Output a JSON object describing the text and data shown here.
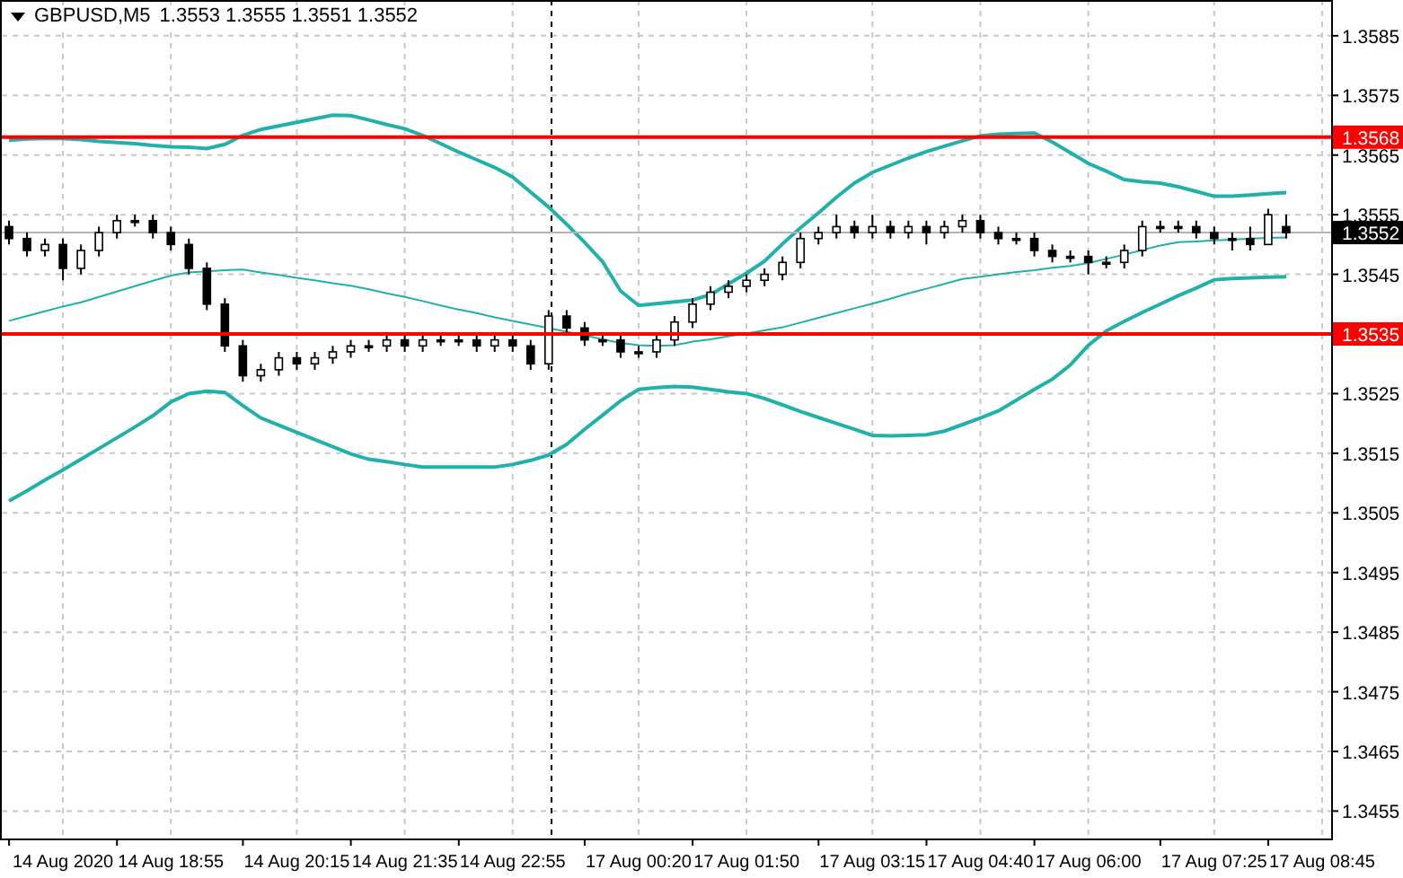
{
  "title": {
    "symbol": "GBPUSD,M5",
    "values": [
      "1.3553",
      "1.3555",
      "1.3551",
      "1.3552"
    ]
  },
  "chart_data": {
    "type": "candlestick",
    "grid": true,
    "categories": [
      null,
      null,
      null,
      "14 Aug 2020",
      null,
      null,
      null,
      null,
      null,
      "14 Aug 18:55",
      null,
      null,
      null,
      null,
      null,
      null,
      "14 Aug 20:15",
      null,
      null,
      null,
      null,
      null,
      "14 Aug 21:35",
      null,
      null,
      null,
      null,
      null,
      "14 Aug 22:55",
      null,
      null,
      null,
      null,
      null,
      null,
      "17 Aug 00:20",
      null,
      null,
      null,
      null,
      null,
      "17 Aug 01:50",
      null,
      null,
      null,
      null,
      null,
      null,
      "17 Aug 03:15",
      null,
      null,
      null,
      null,
      null,
      "17 Aug 04:40",
      null,
      null,
      null,
      null,
      null,
      "17 Aug 06:00",
      null,
      null,
      null,
      null,
      null,
      null,
      "17 Aug 07:25",
      null,
      null,
      null,
      null,
      null,
      "17 Aug 08:45"
    ],
    "ylim": [
      1.34504,
      1.3591
    ],
    "yticks": [
      {
        "value": 1.3455,
        "label": "1.3455"
      },
      {
        "value": 1.3465,
        "label": "1.3465"
      },
      {
        "value": 1.3475,
        "label": "1.3475"
      },
      {
        "value": 1.3485,
        "label": "1.3485"
      },
      {
        "value": 1.3495,
        "label": "1.3495"
      },
      {
        "value": 1.3505,
        "label": "1.3505"
      },
      {
        "value": 1.3515,
        "label": "1.3515"
      },
      {
        "value": 1.3525,
        "label": "1.3525"
      },
      {
        "value": 1.3545,
        "label": "1.3545"
      },
      {
        "value": 1.3555,
        "label": "1.3555"
      },
      {
        "value": 1.3565,
        "label": "1.3565"
      },
      {
        "value": 1.3575,
        "label": "1.3575"
      },
      {
        "value": 1.3585,
        "label": "1.3585"
      }
    ],
    "ohlc": [
      [
        1.3553,
        1.3554,
        1.355,
        1.3551
      ],
      [
        1.3551,
        1.3552,
        1.3548,
        1.3549
      ],
      [
        1.3549,
        1.3551,
        1.3548,
        1.355
      ],
      [
        1.355,
        1.3551,
        1.3544,
        1.3546
      ],
      [
        1.3546,
        1.355,
        1.3545,
        1.3549
      ],
      [
        1.3549,
        1.3553,
        1.3548,
        1.3552
      ],
      [
        1.3552,
        1.3555,
        1.3551,
        1.3554
      ],
      [
        1.3554,
        1.3555,
        1.3553,
        1.3554
      ],
      [
        1.3554,
        1.3555,
        1.3551,
        1.3552
      ],
      [
        1.3552,
        1.3553,
        1.3549,
        1.355
      ],
      [
        1.355,
        1.3551,
        1.3545,
        1.3546
      ],
      [
        1.3546,
        1.3547,
        1.3539,
        1.354
      ],
      [
        1.354,
        1.3541,
        1.3532,
        1.3533
      ],
      [
        1.3533,
        1.3534,
        1.3527,
        1.3528
      ],
      [
        1.3528,
        1.353,
        1.3527,
        1.3529
      ],
      [
        1.3529,
        1.3532,
        1.3528,
        1.3531
      ],
      [
        1.3531,
        1.3532,
        1.3529,
        1.353
      ],
      [
        1.353,
        1.3532,
        1.3529,
        1.3531
      ],
      [
        1.3531,
        1.3533,
        1.353,
        1.3532
      ],
      [
        1.3532,
        1.3534,
        1.3531,
        1.3533
      ],
      [
        1.3533,
        1.3534,
        1.3532,
        1.3533
      ],
      [
        1.3533,
        1.3535,
        1.3532,
        1.3534
      ],
      [
        1.3534,
        1.3535,
        1.3532,
        1.3533
      ],
      [
        1.3533,
        1.3535,
        1.3532,
        1.3534
      ],
      [
        1.3534,
        1.3535,
        1.3533,
        1.3534
      ],
      [
        1.3534,
        1.3535,
        1.3533,
        1.3534
      ],
      [
        1.3534,
        1.3535,
        1.3532,
        1.3533
      ],
      [
        1.3533,
        1.3535,
        1.3532,
        1.3534
      ],
      [
        1.3534,
        1.3535,
        1.3532,
        1.3533
      ],
      [
        1.3533,
        1.3534,
        1.3529,
        1.353
      ],
      [
        1.353,
        1.3539,
        1.3529,
        1.3538
      ],
      [
        1.3538,
        1.3539,
        1.3535,
        1.3536
      ],
      [
        1.3536,
        1.3537,
        1.3533,
        1.3534
      ],
      [
        1.3534,
        1.3535,
        1.3533,
        1.3534
      ],
      [
        1.3534,
        1.3535,
        1.3531,
        1.3532
      ],
      [
        1.3532,
        1.3533,
        1.3531,
        1.3532
      ],
      [
        1.3532,
        1.3535,
        1.3531,
        1.3534
      ],
      [
        1.3534,
        1.3538,
        1.3533,
        1.3537
      ],
      [
        1.3537,
        1.3541,
        1.3536,
        1.354
      ],
      [
        1.354,
        1.3543,
        1.3539,
        1.3542
      ],
      [
        1.3542,
        1.3544,
        1.3541,
        1.3543
      ],
      [
        1.3543,
        1.3545,
        1.3542,
        1.3544
      ],
      [
        1.3544,
        1.3546,
        1.3543,
        1.3545
      ],
      [
        1.3545,
        1.3548,
        1.3544,
        1.3547
      ],
      [
        1.3547,
        1.3552,
        1.3546,
        1.3551
      ],
      [
        1.3551,
        1.3553,
        1.355,
        1.3552
      ],
      [
        1.3552,
        1.3555,
        1.3551,
        1.3553
      ],
      [
        1.3553,
        1.3554,
        1.3551,
        1.3552
      ],
      [
        1.3552,
        1.3555,
        1.3551,
        1.3553
      ],
      [
        1.3553,
        1.3554,
        1.3551,
        1.3552
      ],
      [
        1.3552,
        1.3554,
        1.3551,
        1.3553
      ],
      [
        1.3553,
        1.3554,
        1.355,
        1.3552
      ],
      [
        1.3552,
        1.3554,
        1.3551,
        1.3553
      ],
      [
        1.3553,
        1.3555,
        1.3552,
        1.3554
      ],
      [
        1.3554,
        1.3555,
        1.3551,
        1.3552
      ],
      [
        1.3552,
        1.3553,
        1.355,
        1.3551
      ],
      [
        1.3551,
        1.3552,
        1.355,
        1.3551
      ],
      [
        1.3551,
        1.3552,
        1.3548,
        1.3549
      ],
      [
        1.3549,
        1.355,
        1.3547,
        1.3548
      ],
      [
        1.3548,
        1.3549,
        1.3547,
        1.3548
      ],
      [
        1.3548,
        1.3549,
        1.3545,
        1.3547
      ],
      [
        1.3547,
        1.3548,
        1.3546,
        1.3547
      ],
      [
        1.3547,
        1.355,
        1.3546,
        1.3549
      ],
      [
        1.3549,
        1.3554,
        1.3548,
        1.3553
      ],
      [
        1.3553,
        1.3554,
        1.3552,
        1.3553
      ],
      [
        1.3553,
        1.3554,
        1.3552,
        1.3553
      ],
      [
        1.3553,
        1.3554,
        1.3551,
        1.3552
      ],
      [
        1.3552,
        1.3553,
        1.355,
        1.3551
      ],
      [
        1.3551,
        1.3552,
        1.3549,
        1.3551
      ],
      [
        1.3551,
        1.3553,
        1.3549,
        1.355
      ],
      [
        1.355,
        1.3556,
        1.355,
        1.3555
      ],
      [
        1.3553,
        1.3555,
        1.3551,
        1.3552
      ],
      null,
      null
    ],
    "series": [
      {
        "type": "line",
        "color": "#20b2aa",
        "values": [
          1.35675,
          1.35677,
          1.35678,
          1.35678,
          1.35676,
          1.35673,
          1.35671,
          1.35669,
          1.35666,
          1.35664,
          1.35663,
          1.35661,
          1.35668,
          1.35683,
          1.35693,
          1.35699,
          1.35705,
          1.35711,
          1.35717,
          1.35716,
          1.35709,
          1.35701,
          1.35694,
          1.35683,
          1.35669,
          1.35655,
          1.35642,
          1.35629,
          1.35613,
          1.35588,
          1.35563,
          1.35534,
          1.35504,
          1.35471,
          1.35422,
          1.35398,
          1.35401,
          1.35404,
          1.35407,
          1.35416,
          1.35434,
          1.35452,
          1.35472,
          1.35501,
          1.35528,
          1.35553,
          1.35579,
          1.35603,
          1.35621,
          1.35633,
          1.35645,
          1.35656,
          1.35665,
          1.35674,
          1.35682,
          1.35685,
          1.35686,
          1.35687,
          1.35672,
          1.35654,
          1.35636,
          1.35623,
          1.35609,
          1.35605,
          1.35603,
          1.35597,
          1.35589,
          1.35581,
          1.35581,
          1.35583,
          1.35585,
          1.35587,
          null,
          null
        ]
      },
      {
        "type": "line",
        "color": "#20b2aa",
        "values": [
          1.35372,
          1.3538,
          1.35388,
          1.35396,
          1.35403,
          1.35412,
          1.35421,
          1.3543,
          1.35439,
          1.35448,
          1.35453,
          1.35455,
          1.35457,
          1.35458,
          1.35453,
          1.35449,
          1.35444,
          1.3544,
          1.35435,
          1.35431,
          1.35425,
          1.35418,
          1.35412,
          1.35405,
          1.35398,
          1.35391,
          1.35385,
          1.35378,
          1.35372,
          1.35366,
          1.3536,
          1.35354,
          1.35348,
          1.35341,
          1.35335,
          1.35331,
          1.3533,
          1.35331,
          1.35337,
          1.35341,
          1.35346,
          1.35351,
          1.35356,
          1.35361,
          1.35369,
          1.35377,
          1.35385,
          1.35393,
          1.35401,
          1.35409,
          1.35418,
          1.35426,
          1.35434,
          1.35442,
          1.35446,
          1.3545,
          1.35454,
          1.35457,
          1.35461,
          1.35464,
          1.35469,
          1.35476,
          1.35483,
          1.35491,
          1.35498,
          1.35504,
          1.35505,
          1.35507,
          1.35508,
          1.3551,
          1.35511,
          1.35512,
          null,
          null
        ]
      },
      {
        "type": "line",
        "color": "#20b2aa",
        "values": [
          1.3507,
          1.35087,
          1.35105,
          1.35122,
          1.3514,
          1.35158,
          1.35176,
          1.35194,
          1.35213,
          1.35236,
          1.3525,
          1.35254,
          1.35252,
          1.3523,
          1.35209,
          1.35197,
          1.35185,
          1.35173,
          1.35161,
          1.35149,
          1.3514,
          1.35136,
          1.35131,
          1.35127,
          1.35127,
          1.35127,
          1.35127,
          1.35127,
          1.35131,
          1.35138,
          1.35147,
          1.35165,
          1.3519,
          1.35214,
          1.35238,
          1.35257,
          1.3526,
          1.35262,
          1.35261,
          1.35257,
          1.35253,
          1.3525,
          1.35242,
          1.35231,
          1.3522,
          1.3521,
          1.352,
          1.3519,
          1.3518,
          1.35179,
          1.3518,
          1.35181,
          1.35187,
          1.35198,
          1.35209,
          1.35221,
          1.35239,
          1.35257,
          1.35274,
          1.35298,
          1.35331,
          1.35355,
          1.35371,
          1.35386,
          1.354,
          1.35414,
          1.35427,
          1.35441,
          1.35443,
          1.35444,
          1.35445,
          1.35446,
          null,
          null
        ]
      }
    ],
    "ref_lines": [
      {
        "axis": "y",
        "value": 1.3568,
        "label": "1.3568",
        "color": "#ff0000"
      },
      {
        "axis": "y",
        "value": 1.3535,
        "label": "1.3535",
        "color": "#ff0000"
      },
      {
        "axis": "y",
        "value": 1.3552,
        "label": "1.3552",
        "color": "#b4b4b4"
      }
    ]
  }
}
